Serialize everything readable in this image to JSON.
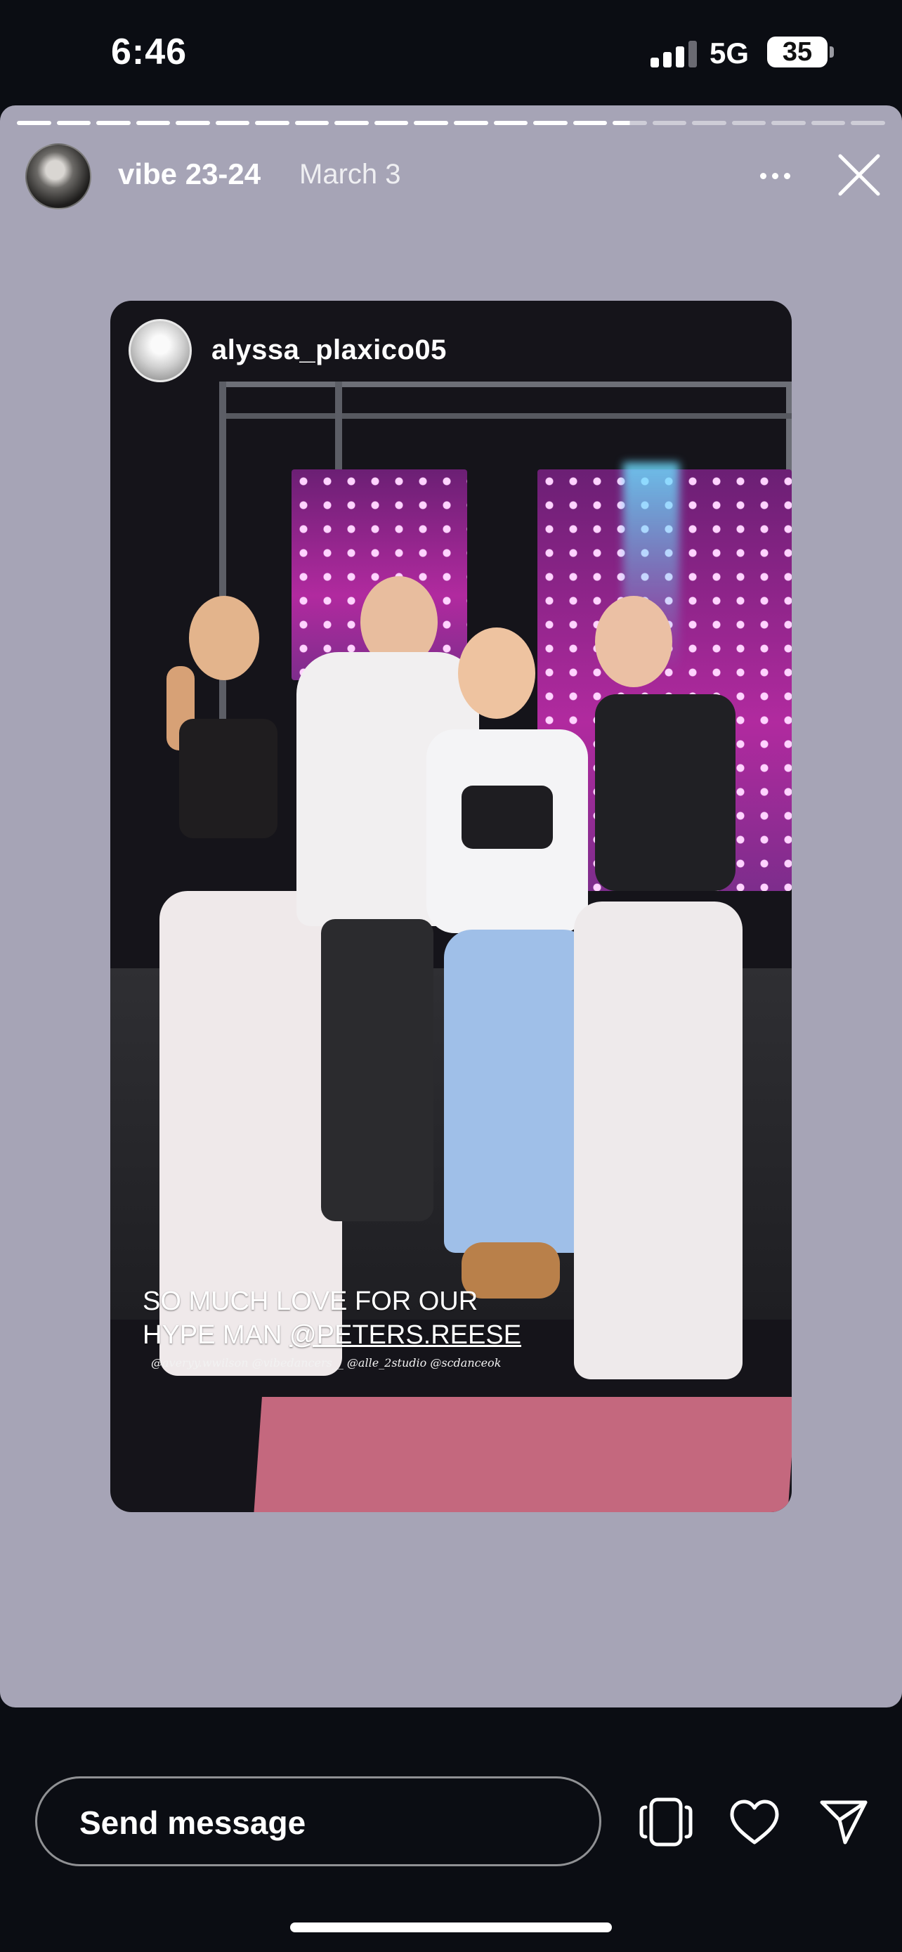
{
  "status_bar": {
    "time": "6:46",
    "network": "5G",
    "battery": "35",
    "signal_bars_active": 3
  },
  "story": {
    "progress_segments": 22,
    "progress_done": 15,
    "account_name": "vibe 23-24",
    "date": "March 3",
    "background_color": "#a6a4b6"
  },
  "reshared_post": {
    "username": "alyssa_plaxico05",
    "caption_line1": "SO MUCH LOVE FOR OUR",
    "caption_line2_prefix": "HYPE MAN ",
    "caption_mention": "@PETERS.REESE",
    "photo_tags": "@averyy.wwilson @vibedancers__  @alle_2studio @scdanceok"
  },
  "bottom_bar": {
    "message_placeholder": "Send message"
  },
  "icons": [
    "more-options-icon",
    "close-icon",
    "reshare-icon",
    "heart-icon",
    "send-icon"
  ]
}
